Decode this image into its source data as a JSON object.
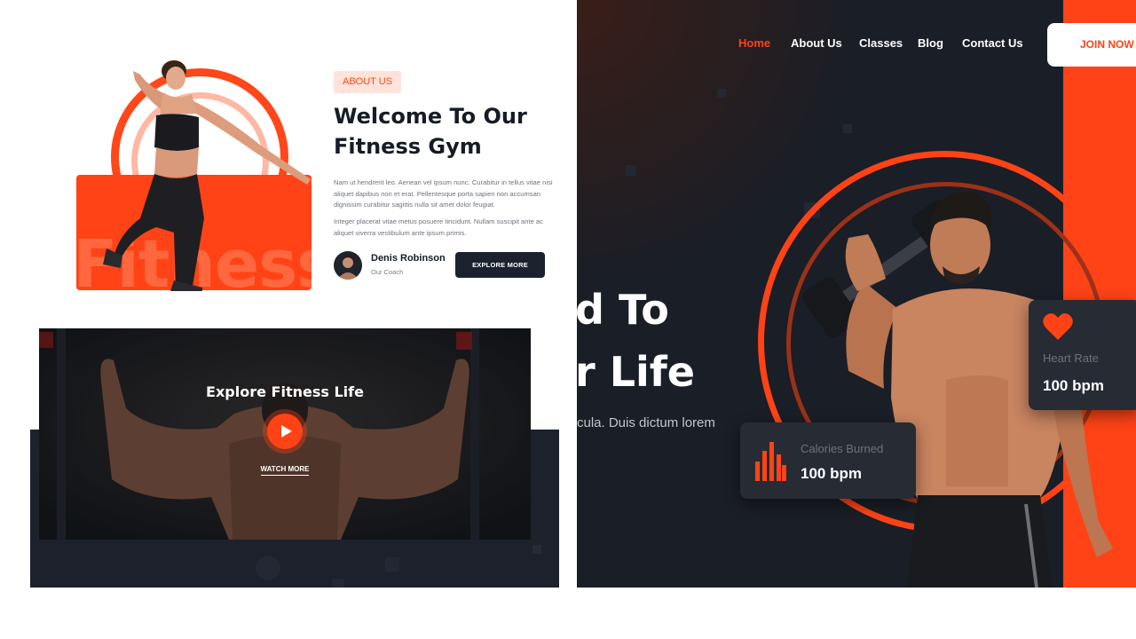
{
  "about": {
    "tag": "ABOUT US",
    "title_line1": "Welcome To Our",
    "title_line2": "Fitness Gym",
    "panel_word": "Fitness",
    "paragraph1": "Nam ut hendrerit leo. Aenean vel ipsum nunc. Curabitur in tellus vitae nisi aliquet dapibus non et erat. Pellentesque porta sapien non accumsan dignissim curabitur sagittis nulla sit amet dolor feugiat.",
    "paragraph2": "Integer placerat vitae metus posuere tincidunt. Nullam suscipit ante ac aliquet viverra vestibulum ante ipsum primis.",
    "coach": {
      "name": "Denis Robinson",
      "role": "Our Coach"
    },
    "explore_button": "EXPLORE MORE"
  },
  "video": {
    "title": "Explore Fitness Life",
    "watch_more": "WATCH MORE",
    "play_icon": "play-icon"
  },
  "hero": {
    "nav": [
      {
        "label": "Home",
        "active": true
      },
      {
        "label": "About Us",
        "active": false
      },
      {
        "label": "Classes",
        "active": false
      },
      {
        "label": "Blog",
        "active": false
      },
      {
        "label": "Contact Us",
        "active": false
      }
    ],
    "join_button": "JOIN NOW",
    "headline_line1": "d To",
    "headline_line2": "r Life",
    "subtext": "cula. Duis dictum lorem",
    "stats": {
      "calories": {
        "label": "Calories Burned",
        "value": "100 bpm",
        "icon": "bar-chart-icon"
      },
      "heart": {
        "label": "Heart Rate",
        "value": "100 bpm",
        "icon": "heart-icon"
      }
    }
  },
  "colors": {
    "accent": "#ff4316",
    "dark": "#1a1e26",
    "text_dark": "#161b26"
  }
}
